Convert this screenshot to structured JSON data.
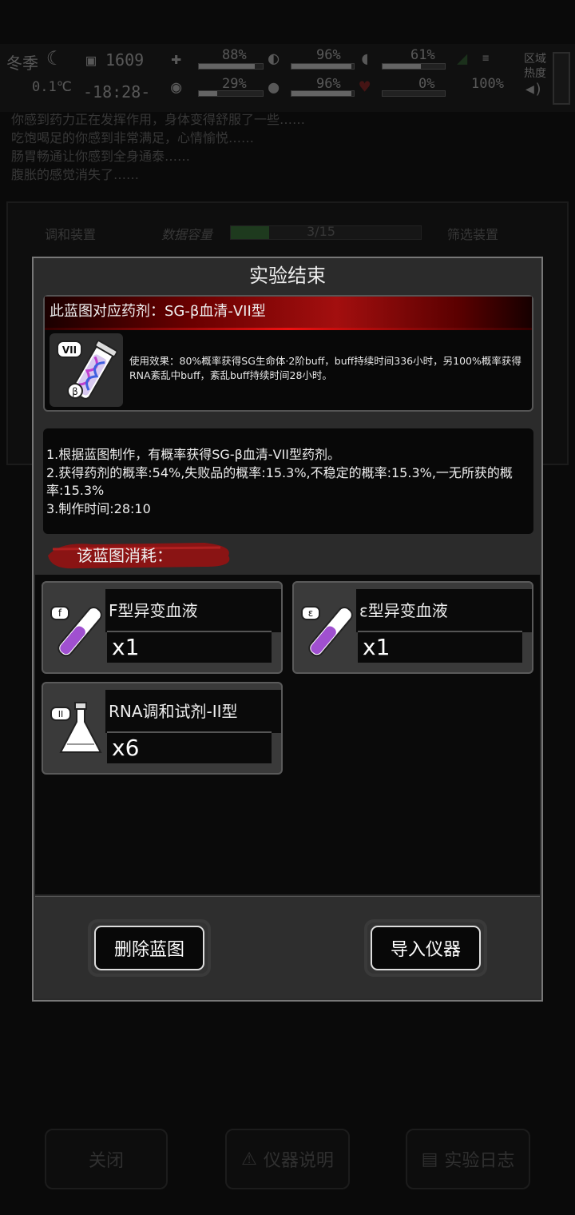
{
  "hud": {
    "season": "冬季",
    "temperature": "0.1℃",
    "day": "1609",
    "time": "-18:28-",
    "stats_row1": [
      "88%",
      "96%",
      "61%"
    ],
    "stats_row2": [
      "29%",
      "96%",
      "0%",
      "100%"
    ],
    "region_label": "区域热度"
  },
  "log_lines": [
    "你感到药力正在发挥作用，身体变得舒服了一些……",
    "吃饱喝足的你感到非常满足，心情愉悦……",
    "肠胃畅通让你感到全身通泰……",
    "腹胀的感觉消失了……"
  ],
  "background_panel": {
    "left_label": "调和装置",
    "capacity_label": "数据容量",
    "capacity_value": "3/15",
    "right_label": "筛选装置"
  },
  "background_buttons": {
    "close": "关闭",
    "instrument_info": "仪器说明",
    "experiment_log": "实验日志"
  },
  "modal": {
    "title": "实验结束",
    "blueprint_header": "此蓝图对应药剂：SG-β血清-VII型",
    "potion_badge": "VII",
    "effect_text": "使用效果：80%概率获得SG生命体·2阶buff，buff持续时间336小时，另100%概率获得RNA紊乱中buff，紊乱buff持续时间28小时。",
    "info_lines": [
      "1.根据蓝图制作，有概率获得SG-β血清-VII型药剂。",
      "2.获得药剂的概率:54%,失败品的概率:15.3%,不稳定的概率:15.3%,一无所获的概率:15.3%",
      "3.制作时间:28:10"
    ],
    "consume_label": "该蓝图消耗：",
    "materials": [
      {
        "badge": "f",
        "name": "F型异变血液",
        "qty": "x1",
        "icon": "test-tube-icon"
      },
      {
        "badge": "ε",
        "name": "ε型异变血液",
        "qty": "x1",
        "icon": "test-tube-icon"
      },
      {
        "badge": "II",
        "name": "RNA调和试剂-II型",
        "qty": "x6",
        "icon": "flask-icon"
      }
    ],
    "delete_button": "删除蓝图",
    "import_button": "导入仪器"
  },
  "colors": {
    "accent_red": "#a30f0f",
    "liquid_purple": "#a050d0"
  }
}
